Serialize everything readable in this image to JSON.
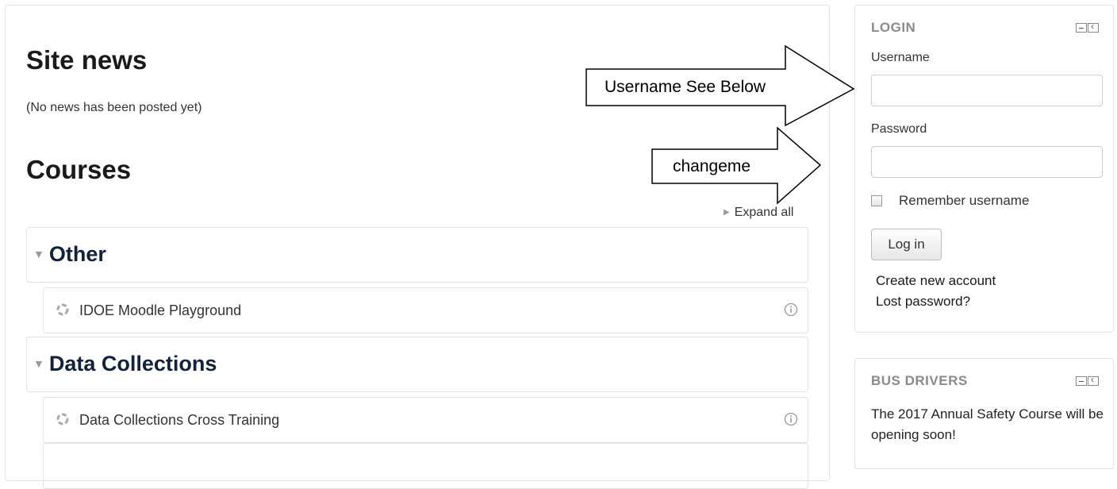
{
  "main": {
    "site_news_title": "Site news",
    "no_news_text": "(No news has been posted yet)",
    "courses_title": "Courses",
    "expand_all": "Expand all",
    "categories": [
      {
        "title": "Other",
        "courses": [
          {
            "name": "IDOE Moodle Playground"
          }
        ]
      },
      {
        "title": "Data Collections",
        "courses": [
          {
            "name": "Data Collections Cross Training"
          }
        ]
      }
    ]
  },
  "login_block": {
    "title": "LOGIN",
    "username_label": "Username",
    "username_value": "",
    "password_label": "Password",
    "password_value": "",
    "remember_label": "Remember username",
    "remember_checked": false,
    "login_button": "Log in",
    "create_account": "Create new account",
    "lost_password": "Lost password?"
  },
  "bus_block": {
    "title": "BUS DRIVERS",
    "text": "The 2017 Annual Safety Course will be opening soon!"
  },
  "annotations": {
    "username_arrow_label": "Username See Below",
    "password_arrow_label": "changeme"
  },
  "icons": {
    "expand": "expand-triangle-icon",
    "collapse": "collapse-triangle-icon",
    "course": "course-icon",
    "info": "info-icon",
    "minimize": "minimize-icon",
    "dock": "dock-icon"
  }
}
